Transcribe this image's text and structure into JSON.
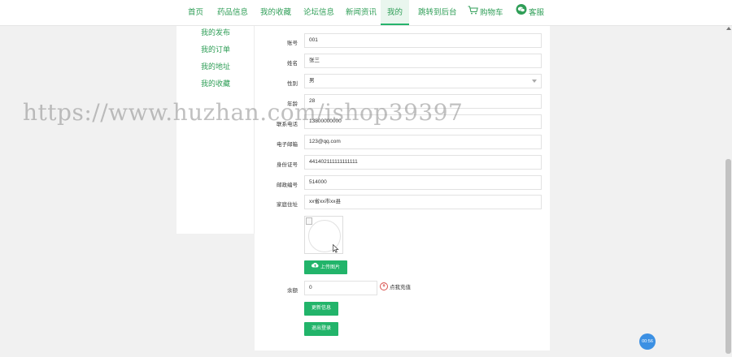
{
  "nav": {
    "items": [
      {
        "label": "首页"
      },
      {
        "label": "药品信息"
      },
      {
        "label": "我的收藏"
      },
      {
        "label": "论坛信息"
      },
      {
        "label": "新闻资讯"
      },
      {
        "label": "我的"
      },
      {
        "label": "跳转到后台"
      },
      {
        "label": "购物车",
        "icon": "cart-icon"
      },
      {
        "label": "客服",
        "icon": "wechat-icon"
      }
    ],
    "active": "我的",
    "accent": "#26b36c"
  },
  "sidebar": {
    "items": [
      {
        "label": "我的发布"
      },
      {
        "label": "我的订单"
      },
      {
        "label": "我的地址"
      },
      {
        "label": "我的收藏"
      }
    ]
  },
  "form": {
    "fields": [
      {
        "label": "账号",
        "value": "001"
      },
      {
        "label": "姓名",
        "value": "张三"
      },
      {
        "label": "性别",
        "value": "男"
      },
      {
        "label": "年龄",
        "value": "28"
      },
      {
        "label": "联系电话",
        "value": "13800000000"
      },
      {
        "label": "电子邮箱",
        "value": "123@qq.com"
      },
      {
        "label": "身份证号",
        "value": "441402111111111111"
      },
      {
        "label": "邮政编号",
        "value": "514000"
      },
      {
        "label": "家庭住址",
        "value": "xx省xx市xx县"
      }
    ],
    "upload_label": "上传图片",
    "balance_label": "余额",
    "balance_value": "0",
    "recharge_symbol": "¥",
    "recharge_label": "点我充值",
    "update_button": "更新信息",
    "logout_button": "退出登录"
  },
  "watermark": "https://www.huzhan.com/ishop39397",
  "float_badge": "00:56",
  "colors": {
    "primary": "#22b46a",
    "link": "#2f9e57",
    "badge": "#3c90e3",
    "recharge": "#d9534f"
  }
}
